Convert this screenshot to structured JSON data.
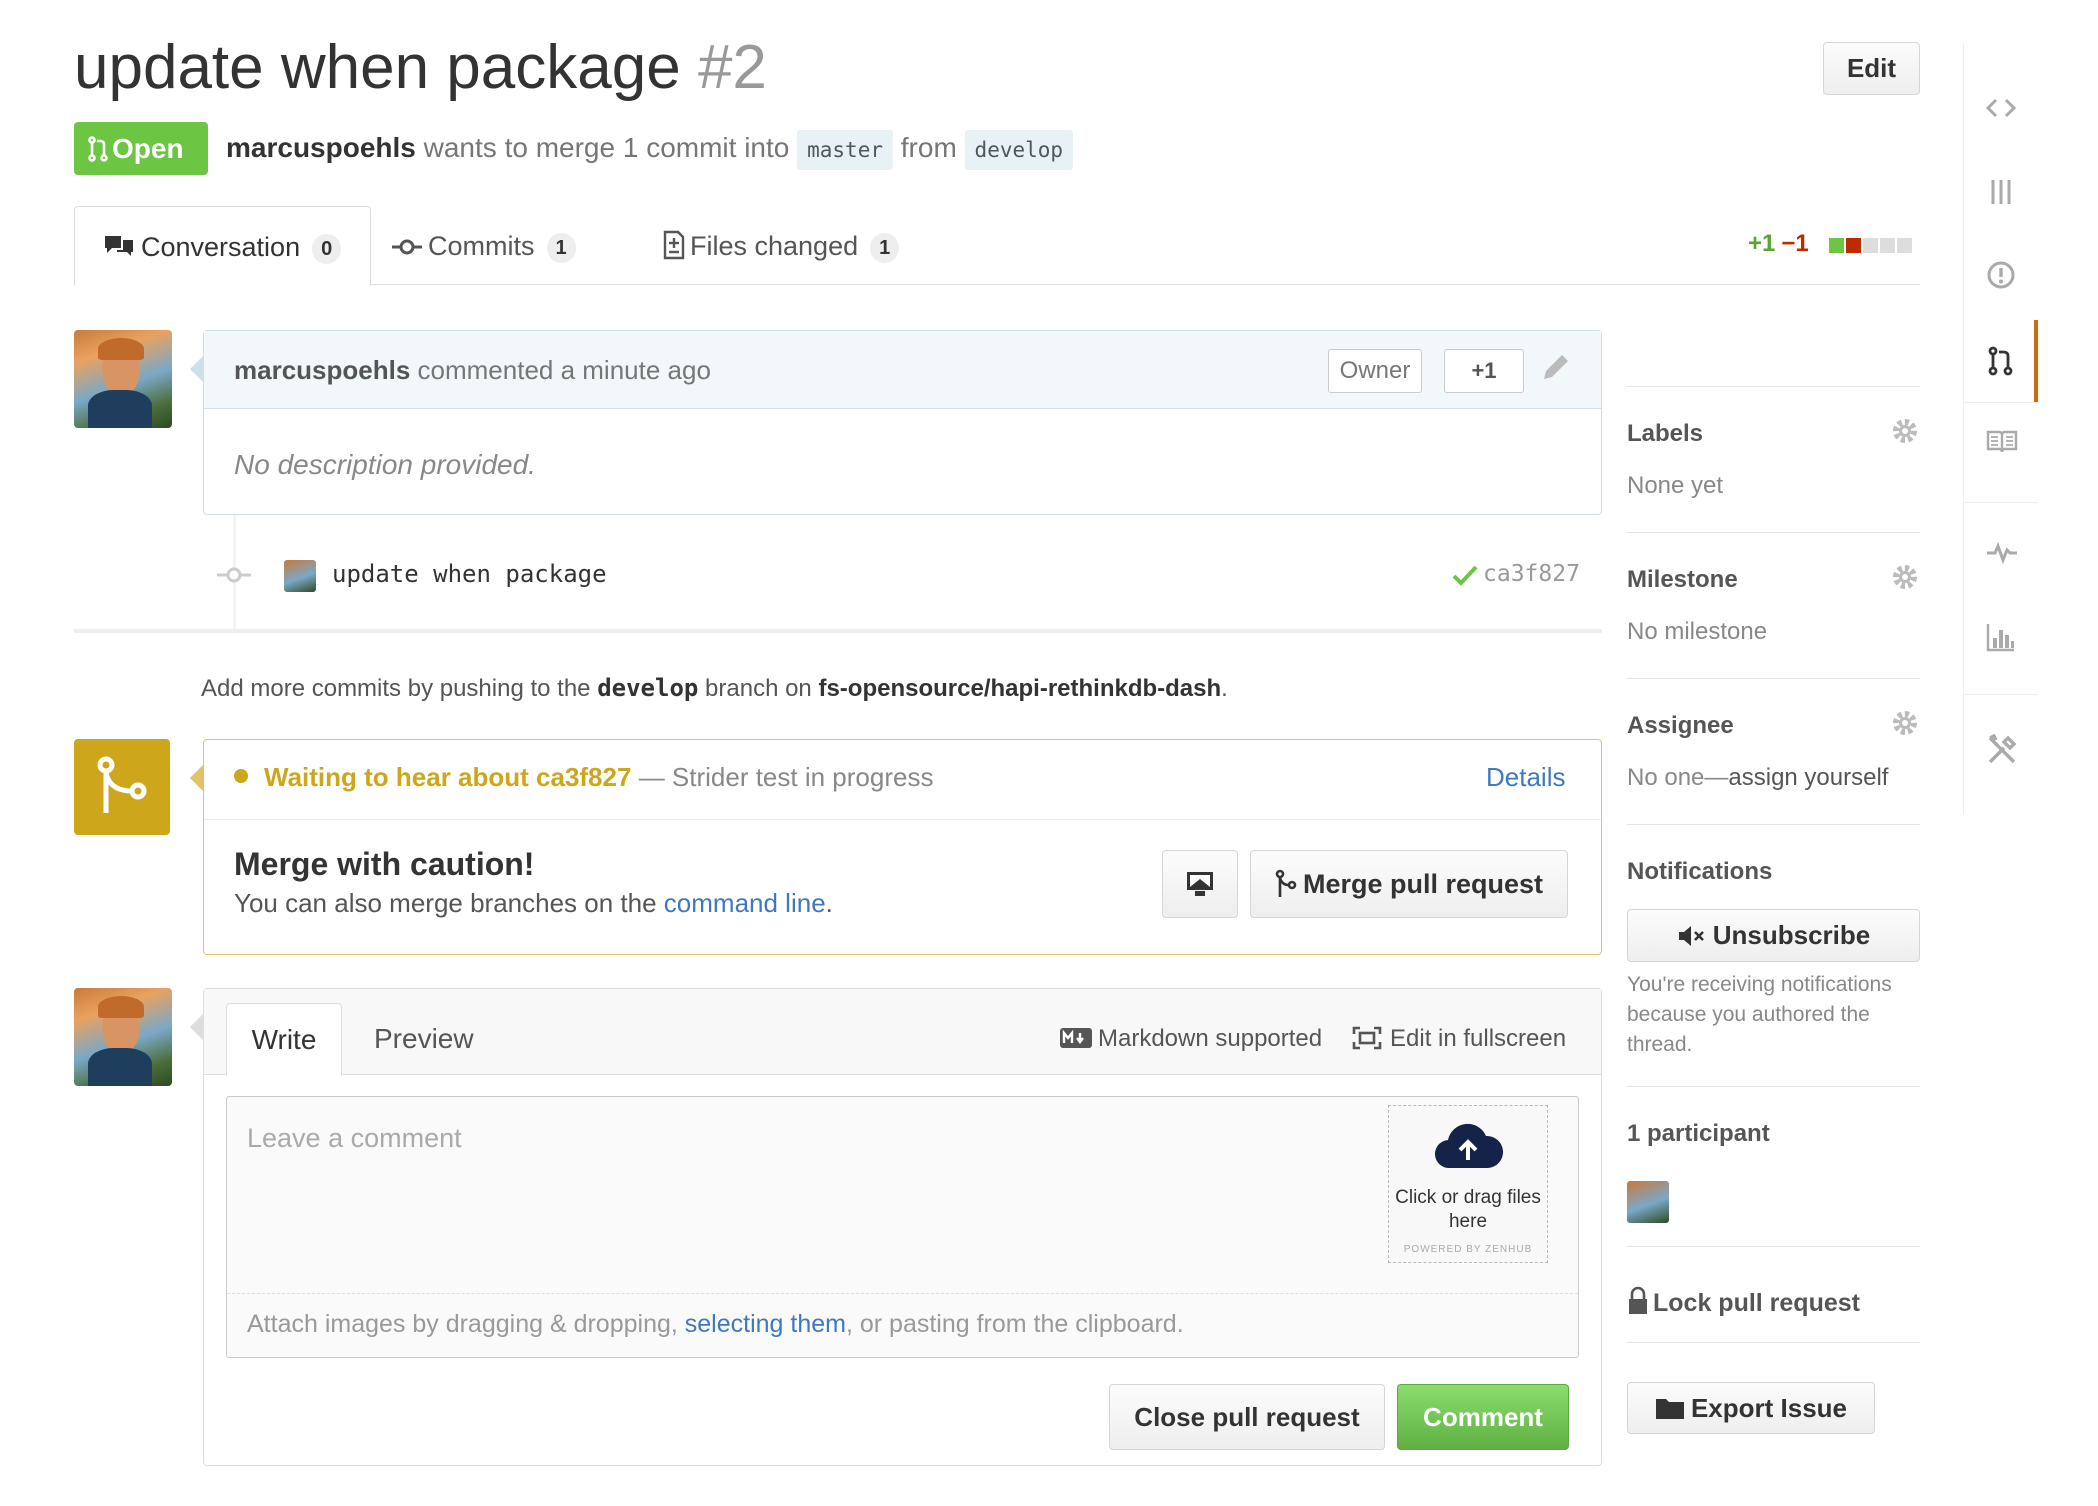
{
  "pr": {
    "title": "update when package",
    "number": "#2",
    "edit_label": "Edit",
    "state": "Open",
    "author": "marcuspoehls",
    "merge_text": "wants to merge 1 commit into",
    "base_branch": "master",
    "from_text": "from",
    "head_branch": "develop"
  },
  "tabs": [
    {
      "label": "Conversation",
      "count": "0"
    },
    {
      "label": "Commits",
      "count": "1"
    },
    {
      "label": "Files changed",
      "count": "1"
    }
  ],
  "diffstat": {
    "additions": "+1",
    "deletions": "−1"
  },
  "comment": {
    "author": "marcuspoehls",
    "action": "commented a minute ago",
    "owner_badge": "Owner",
    "plus_one": "+1",
    "body": "No description provided."
  },
  "commit": {
    "message": "update when package",
    "sha": "ca3f827"
  },
  "add_more": {
    "prefix": "Add more commits by pushing to the",
    "branch": "develop",
    "middle": "branch on",
    "repo": "fs-opensource/hapi-rethinkdb-dash",
    "suffix": "."
  },
  "merge": {
    "status_wait": "Waiting to hear about ca3f827",
    "status_rest": "— Strider test in progress",
    "details": "Details",
    "title": "Merge with caution!",
    "sub_prefix": "You can also merge branches on the",
    "sub_link": "command line",
    "sub_suffix": ".",
    "merge_button": "Merge pull request"
  },
  "composer": {
    "write_tab": "Write",
    "preview_tab": "Preview",
    "markdown": "Markdown supported",
    "fullscreen": "Edit in fullscreen",
    "placeholder": "Leave a comment",
    "dropzone_text": "Click or drag files here",
    "dropzone_powered": "POWERED BY ZENHUB",
    "attach_prefix": "Attach images by dragging & dropping,",
    "attach_link": "selecting them",
    "attach_suffix": ", or pasting from the clipboard.",
    "close_button": "Close pull request",
    "comment_button": "Comment"
  },
  "sidebar": {
    "labels_title": "Labels",
    "labels_value": "None yet",
    "milestone_title": "Milestone",
    "milestone_value": "No milestone",
    "assignee_title": "Assignee",
    "assignee_prefix": "No one—",
    "assignee_link": "assign yourself",
    "notifications_title": "Notifications",
    "unsubscribe": "Unsubscribe",
    "notifications_note": "You're receiving notifications because you authored the thread.",
    "participants": "1 participant",
    "lock": "Lock pull request",
    "export": "Export Issue"
  },
  "repo_nav": [
    "code-icon",
    "projects-icon",
    "issues-icon",
    "pull-requests-icon",
    "wiki-icon",
    "pulse-icon",
    "graphs-icon",
    "settings-icon"
  ],
  "colors": {
    "open": "#6cc644",
    "pending": "#cea61b",
    "link": "#4078c0",
    "accent": "#d26911"
  }
}
